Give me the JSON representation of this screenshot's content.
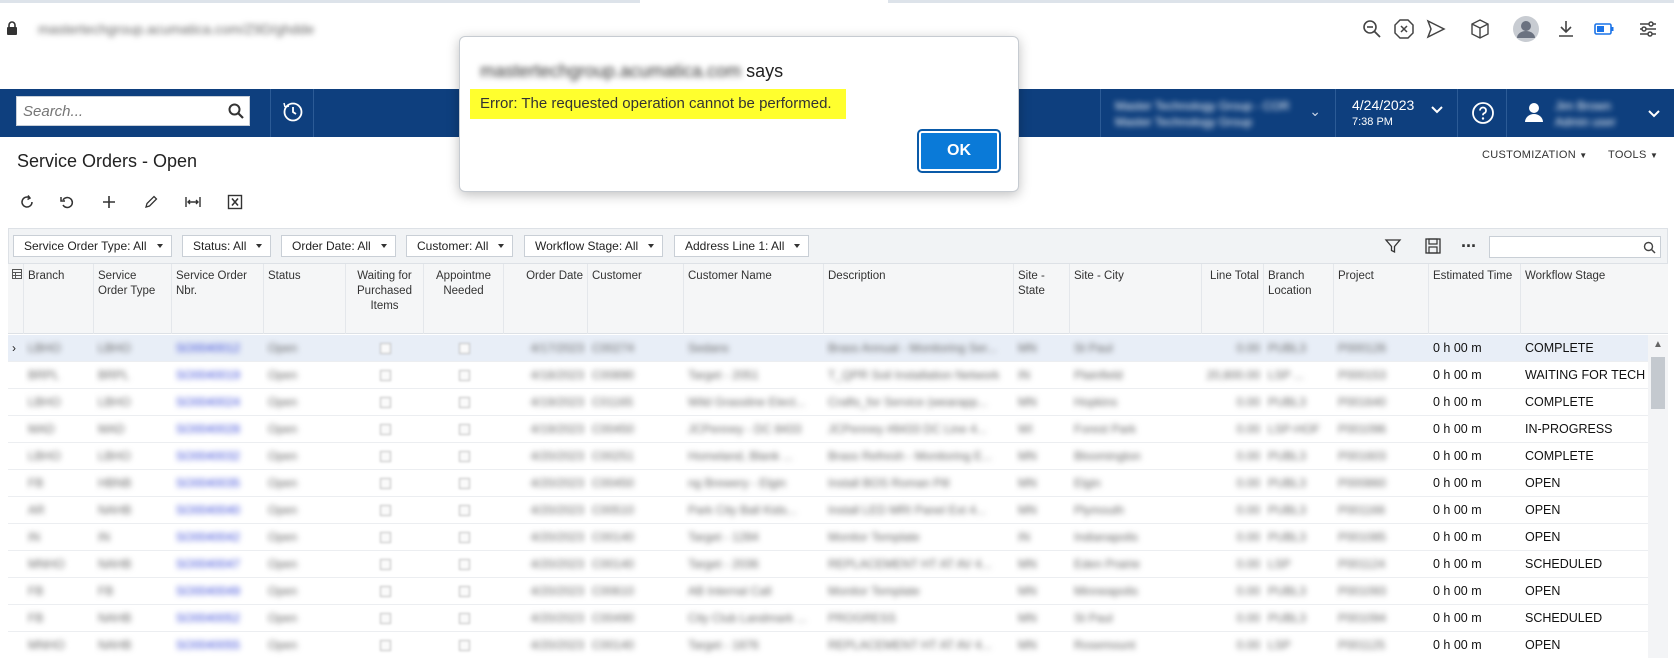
{
  "browser": {
    "url": "mastertechgroup.acumatica.com/Z9D/ghdde",
    "icons": [
      "zoom-out-icon",
      "stop-icon",
      "send-icon",
      "cube-icon",
      "profile-icon",
      "download-icon",
      "battery-icon",
      "settings-sliders-icon"
    ]
  },
  "header": {
    "search_placeholder": "Search...",
    "company_line1": "Master Technology Group - CORP",
    "company_line2": "Master Technology Group",
    "date": "4/24/2023",
    "time": "7:38 PM",
    "user_line1": "Jim Brown",
    "user_line2": "Admin user"
  },
  "page": {
    "title": "Service Orders - Open",
    "menu_customization": "CUSTOMIZATION",
    "menu_tools": "TOOLS"
  },
  "toolbar": {
    "icons": [
      "refresh-icon",
      "undo-icon",
      "add-icon",
      "edit-icon",
      "fit-columns-icon",
      "excel-export-icon"
    ]
  },
  "filters": [
    "Service Order Type: All",
    "Status: All",
    "Order Date: All",
    "Customer: All",
    "Workflow Stage: All",
    "Address Line 1: All"
  ],
  "more_label": "...",
  "columns": [
    "Branch",
    "Service Order Type",
    "Service Order Nbr.",
    "Status",
    "Waiting for Purchased Items",
    "Appointme Needed",
    "Order Date",
    "Customer",
    "Customer Name",
    "Description",
    "Site - State",
    "Site - City",
    "Line Total",
    "Branch Location",
    "Project",
    "Estimated Time",
    "Workflow Stage"
  ],
  "rows": [
    {
      "branch": "LBHO",
      "type": "LBHO",
      "nbr": "SO0040012",
      "status": "Open",
      "date": "4/17/2023",
      "cust": "C00274",
      "name": "Sedans",
      "desc": "Brass Annual - Monitoring Ser...",
      "state": "MN",
      "city": "St Paul",
      "total": "0.00",
      "loc": "PUBL3",
      "project": "P000126",
      "est": "0 h 00 m",
      "stage": "COMPLETE"
    },
    {
      "branch": "BRPL",
      "type": "BRPL",
      "nbr": "SO0040019",
      "status": "Open",
      "date": "4/18/2023",
      "cust": "C00890",
      "name": "Target - 2051",
      "desc": "T_QPR Soil Installation Network",
      "state": "IN",
      "city": "Plainfield",
      "total": "20,800.00",
      "loc": "LSP ...",
      "project": "P000153",
      "est": "0 h 00 m",
      "stage": "WAITING FOR TECH NOTES"
    },
    {
      "branch": "LBHO",
      "type": "LBHO",
      "nbr": "SO0040024",
      "status": "Open",
      "date": "4/19/2023",
      "cust": "C01165",
      "name": "Wild Grassline Elect...",
      "desc": "Crafts_for Service (wearapp...",
      "state": "MN",
      "city": "Hopkins",
      "total": "0.00",
      "loc": "PUBL3",
      "project": "P001640",
      "est": "0 h 00 m",
      "stage": "COMPLETE"
    },
    {
      "branch": "MAD",
      "type": "MAD",
      "nbr": "SO0040028",
      "status": "Open",
      "date": "4/19/2023",
      "cust": "C00450",
      "name": "JCPenney - DC 8433",
      "desc": "JCPenney #8433 DC Line 4...",
      "state": "WI",
      "city": "Forest Park",
      "total": "0.00",
      "loc": "LSP-HOF",
      "project": "P001096",
      "est": "0 h 00 m",
      "stage": "IN-PROGRESS"
    },
    {
      "branch": "LBHO",
      "type": "LBHO",
      "nbr": "SO0040032",
      "status": "Open",
      "date": "4/20/2023",
      "cust": "C00251",
      "name": "Homeland, Blank ...",
      "desc": "Brass Refresh - Monitoring E...",
      "state": "MN",
      "city": "Bloomington",
      "total": "0.00",
      "loc": "PUBL3",
      "project": "P001603",
      "est": "0 h 00 m",
      "stage": "COMPLETE"
    },
    {
      "branch": "FB",
      "type": "HBNB",
      "nbr": "SO0040035",
      "status": "Open",
      "date": "4/20/2023",
      "cust": "C00450",
      "name": "ng Brewery - Elgin",
      "desc": "Install BOS Roman Pill",
      "state": "MN",
      "city": "Elgin",
      "total": "0.00",
      "loc": "PUBL3",
      "project": "P000860",
      "est": "0 h 00 m",
      "stage": "OPEN"
    },
    {
      "branch": "AR",
      "type": "NAHB",
      "nbr": "SO0040040",
      "status": "Open",
      "date": "4/20/2023",
      "cust": "C00510",
      "name": "Park City Ball Kids...",
      "desc": "Install LED MRI Panel Ext 4...",
      "state": "MN",
      "city": "Plymouth",
      "total": "0.00",
      "loc": "PUBL3",
      "project": "P001166",
      "est": "0 h 00 m",
      "stage": "OPEN"
    },
    {
      "branch": "IN",
      "type": "IN",
      "nbr": "SO0040042",
      "status": "Open",
      "date": "4/20/2023",
      "cust": "C00140",
      "name": "Target - 1284",
      "desc": "Monitor Template",
      "state": "IN",
      "city": "Indianapolis",
      "total": "0.00",
      "loc": "PUBL3",
      "project": "P001085",
      "est": "0 h 00 m",
      "stage": "OPEN"
    },
    {
      "branch": "MNHO",
      "type": "NAHB",
      "nbr": "SO0040047",
      "status": "Open",
      "date": "4/20/2023",
      "cust": "C00140",
      "name": "Target - 2036",
      "desc": "REPLACEMENT HT AT AV 4...",
      "state": "MN",
      "city": "Eden Prairie",
      "total": "0.00",
      "loc": "LSP",
      "project": "P001124",
      "est": "0 h 00 m",
      "stage": "SCHEDULED"
    },
    {
      "branch": "FB",
      "type": "FB",
      "nbr": "SO0040049",
      "status": "Open",
      "date": "4/20/2023",
      "cust": "C00610",
      "name": "AB Internal Call",
      "desc": "Monitor Template",
      "state": "MN",
      "city": "Minneapolis",
      "total": "0.00",
      "loc": "PUBL3",
      "project": "P001093",
      "est": "0 h 00 m",
      "stage": "OPEN"
    },
    {
      "branch": "FB",
      "type": "NAHB",
      "nbr": "SO0040052",
      "status": "Open",
      "date": "4/20/2023",
      "cust": "C00490",
      "name": "City Club Landmark ...",
      "desc": "PROGRESS",
      "state": "MN",
      "city": "St Paul",
      "total": "0.00",
      "loc": "PUBL3",
      "project": "P001094",
      "est": "0 h 00 m",
      "stage": "SCHEDULED"
    },
    {
      "branch": "MNHO",
      "type": "NAHB",
      "nbr": "SO0040055",
      "status": "Open",
      "date": "4/20/2023",
      "cust": "C00140",
      "name": "Target - 1876",
      "desc": "REPLACEMENT HT AT AV 4...",
      "state": "MN",
      "city": "Rosemount",
      "total": "0.00",
      "loc": "LSP",
      "project": "P001125",
      "est": "0 h 00 m",
      "stage": "OPEN"
    }
  ],
  "alert": {
    "origin_host": "mastertechgroup.acumatica.com",
    "origin_suffix": "says",
    "message": "Error: The requested operation cannot be performed.",
    "ok_label": "OK",
    "highlight_color": "#ffff2e",
    "ok_color": "#0a7ad8"
  },
  "colors": {
    "header_bg": "#0e3f7e",
    "selected_row": "#e8eef7"
  }
}
